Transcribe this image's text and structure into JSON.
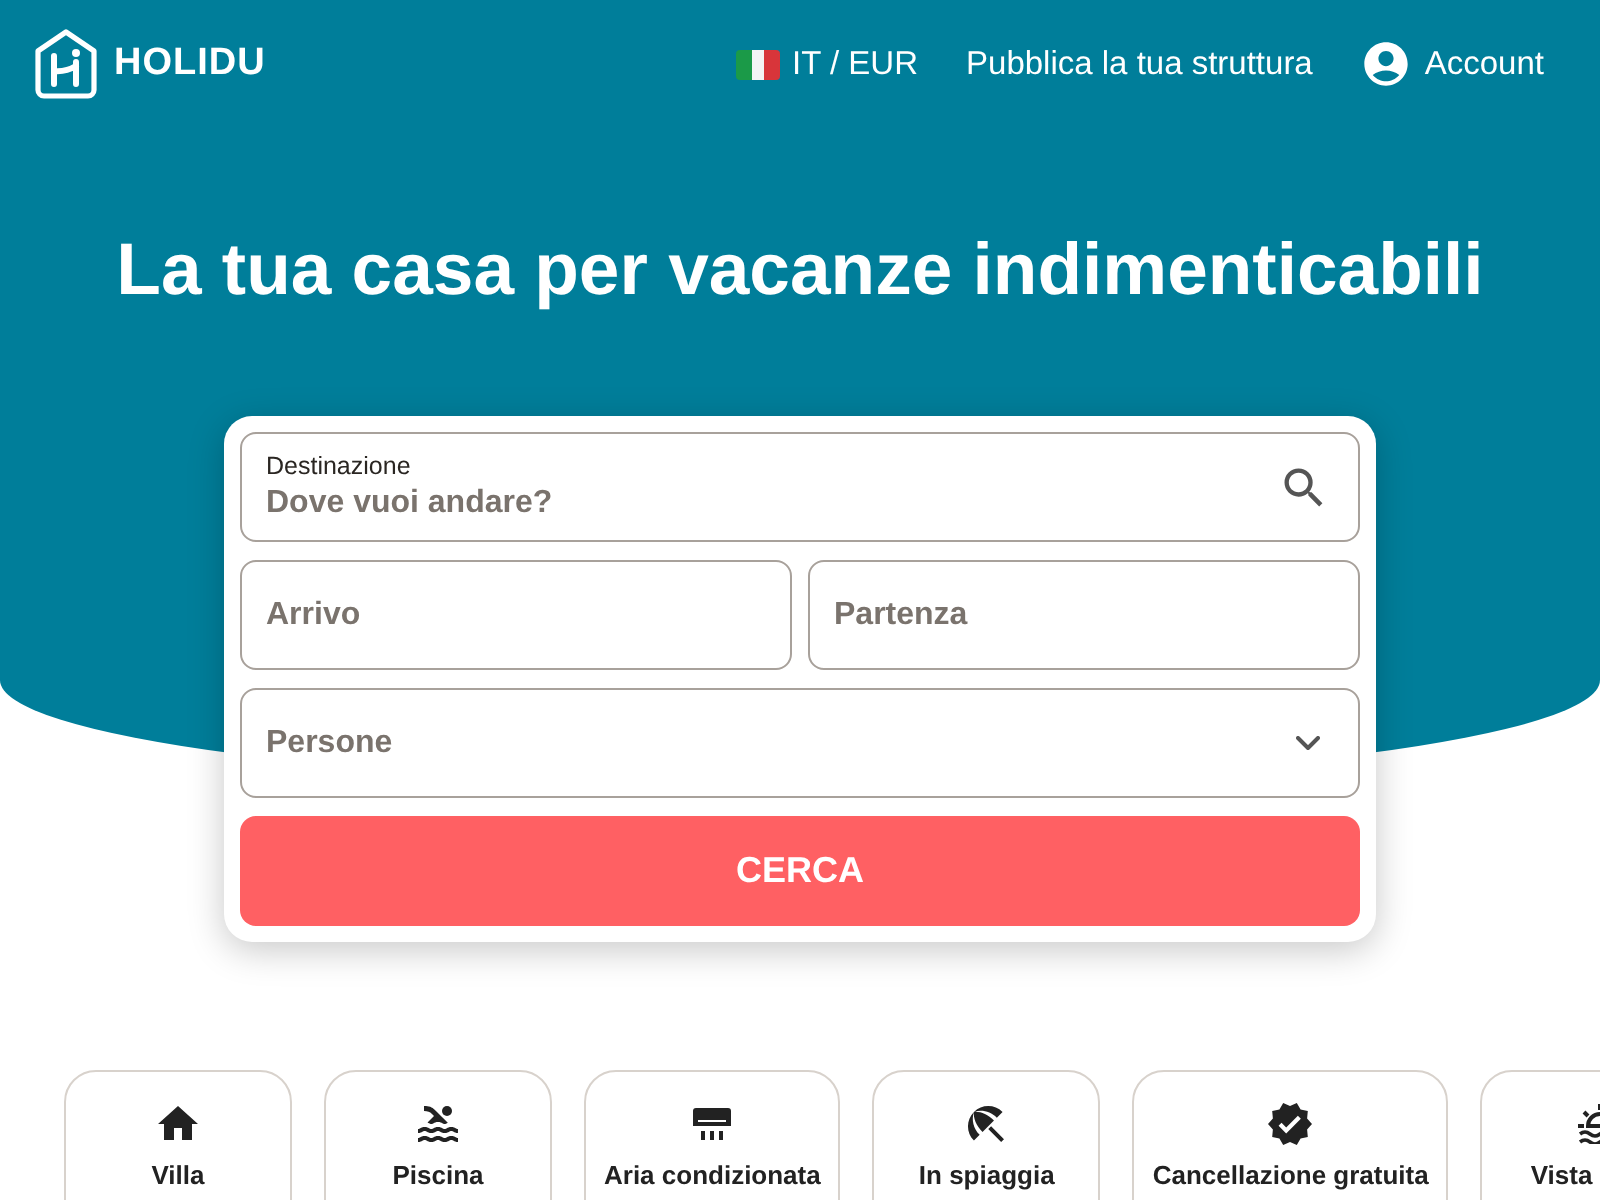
{
  "header": {
    "logo": {
      "name": "HOLIDU"
    },
    "nav": [
      {
        "kind": "locale",
        "label": "IT / EUR"
      },
      {
        "kind": "link",
        "label": "Pubblica la tua struttura"
      },
      {
        "kind": "account",
        "label": "Account"
      }
    ]
  },
  "hero": {
    "title": "La tua casa per vacanze indimenticabili"
  },
  "search_form": {
    "destination": {
      "label": "Destinazione",
      "placeholder": "Dove vuoi andare?"
    },
    "check_in": {
      "placeholder": "Arrivo"
    },
    "check_out": {
      "placeholder": "Partenza"
    },
    "guests": {
      "placeholder": "Persone"
    },
    "submit": {
      "label": "CERCA"
    }
  },
  "categories": [
    {
      "kind": "house",
      "title": "Villa"
    },
    {
      "kind": "pool",
      "title": "Piscina"
    },
    {
      "kind": "aircon",
      "title": "Aria condizionata"
    },
    {
      "kind": "beach",
      "title": "In spiaggia"
    },
    {
      "kind": "badge",
      "title": "Cancellazione gratuita"
    },
    {
      "kind": "sunrise",
      "title": "Vista"
    }
  ]
}
